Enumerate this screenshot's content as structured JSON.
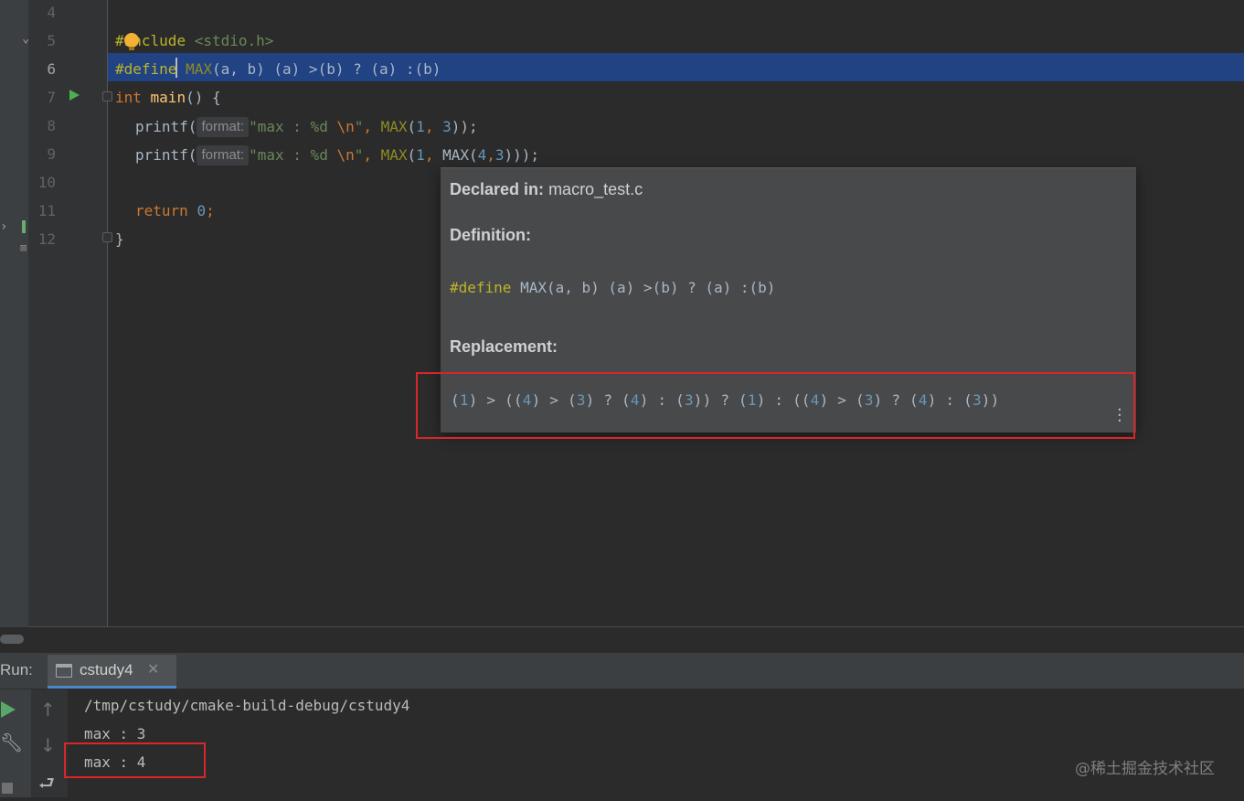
{
  "editor": {
    "line_numbers": [
      "4",
      "5",
      "6",
      "7",
      "8",
      "9",
      "10",
      "11",
      "12"
    ],
    "current_line": "6",
    "lines": {
      "l5": {
        "hash": "#",
        "directive": "include",
        "header": " <stdio.h>"
      },
      "l6": {
        "directive": "#define",
        "macro": " MAX",
        "rest": "(a, b) (a) >(b) ? (a) :(b)"
      },
      "l7": {
        "kw": "int",
        "fn": " main",
        "rest": "() {"
      },
      "l8": {
        "call": "printf(",
        "hint": "format:",
        "str": "\"max : %d ",
        "esc": "\\n",
        "str_end": "\"",
        "comma": ", ",
        "macro": "MAX",
        "open": "(",
        "n1": "1",
        "sep": ", ",
        "n2": "3",
        "close": "));"
      },
      "l9": {
        "call": "printf(",
        "hint": "format:",
        "str": "\"max : %d ",
        "esc": "\\n",
        "str_end": "\"",
        "comma": ", ",
        "macro": "MAX",
        "open": "(",
        "n1": "1",
        "sep": ", ",
        "inner": "MAX(",
        "n2": "4",
        "sep2": ",",
        "n3": "3",
        "close": ")));"
      },
      "l11": {
        "kw": "return",
        "sp": " ",
        "num": "0",
        "semi": ";"
      },
      "l12": {
        "brace": "}"
      }
    }
  },
  "popup": {
    "declared_label": "Declared in:",
    "declared_file": "macro_test.c",
    "definition_label": "Definition:",
    "definition_directive": "#define",
    "definition_macro": " MAX",
    "definition_rest": "(a, b) (a) >(b) ? (a) :(b)",
    "replacement_label": "Replacement:",
    "replacement_text": "(1) > ((4) > (3) ? (4) : (3)) ? (1) : ((4) > (3) ? (4) : (3))",
    "more_icon": "vertical-ellipsis"
  },
  "run_panel": {
    "label": "Run:",
    "tab_name": "cstudy4",
    "close_glyph": "✕",
    "output": [
      "/tmp/cstudy/cmake-build-debug/cstudy4",
      "max : 3",
      "max : 4"
    ]
  },
  "watermark": "@稀土掘金技术社区",
  "colors": {
    "highlight": "#214283",
    "popup_bg": "#48494b",
    "annotation_red": "#d9262b",
    "keyword": "#cc7832",
    "number": "#6897bb",
    "string": "#6a8759"
  }
}
